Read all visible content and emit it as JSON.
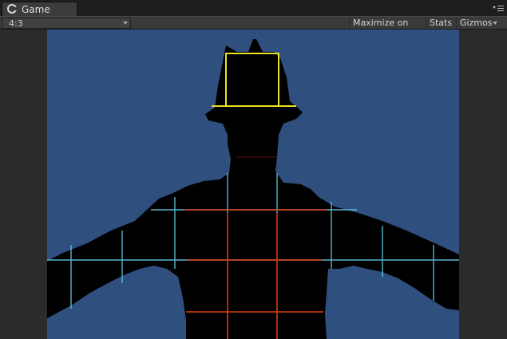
{
  "tab": {
    "title": "Game",
    "icon": "unity-logo-icon"
  },
  "toolbar": {
    "aspect_ratio": "4:3",
    "maximize_on_play": "Maximize on Play",
    "stats": "Stats",
    "gizmos": "Gizmos"
  },
  "viewport": {
    "background_color": "#2f4f7f",
    "silhouette_color": "#000000",
    "grid_colors": {
      "head": "#e8e020",
      "cyan": "#5fc8e6",
      "red": "#e03a12"
    }
  }
}
